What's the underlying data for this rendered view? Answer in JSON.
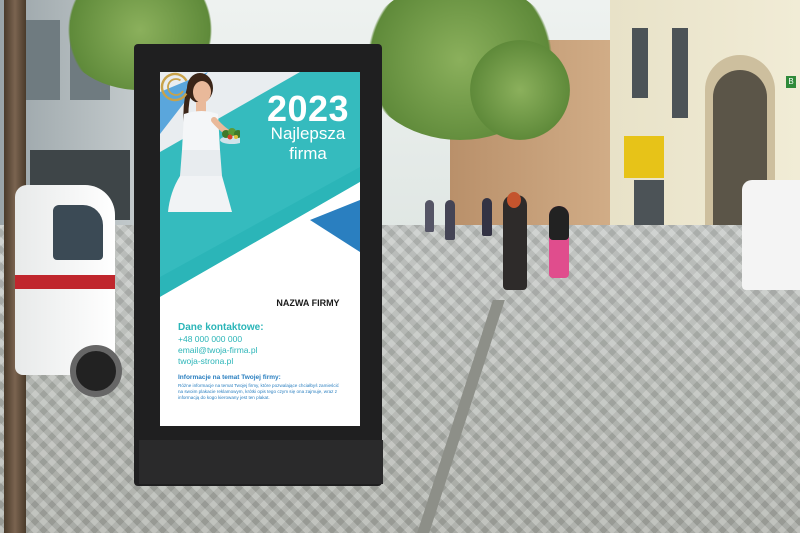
{
  "poster": {
    "year": "2023",
    "headline": "Najlepsza firma",
    "company_name": "NAZWA FIRMY",
    "contact": {
      "title": "Dane kontaktowe:",
      "phone": "+48 000 000 000",
      "email": "email@twoja-firma.pl",
      "website": "twoja-strona.pl"
    },
    "info": {
      "title": "Informacje na temat Twojej firmy:",
      "text": "Różne informacje na temat Twojej firmy, które pozwalające chciałbyś zamieścić na swoim plakacie reklamowym, krótki opis tego czym się ona zajmuje, wraz z informacją do kogo kierowany jest ten plakat."
    },
    "colors": {
      "teal": "#2bb5b8",
      "blue": "#2a7fc0",
      "light_blue": "#5aa6dc",
      "logo_gold": "#c8a24a"
    }
  },
  "scene": {
    "shop_sign": "B",
    "icons": [
      "tree",
      "van",
      "pedestrians",
      "street-lamp",
      "logo-c-icon"
    ]
  }
}
